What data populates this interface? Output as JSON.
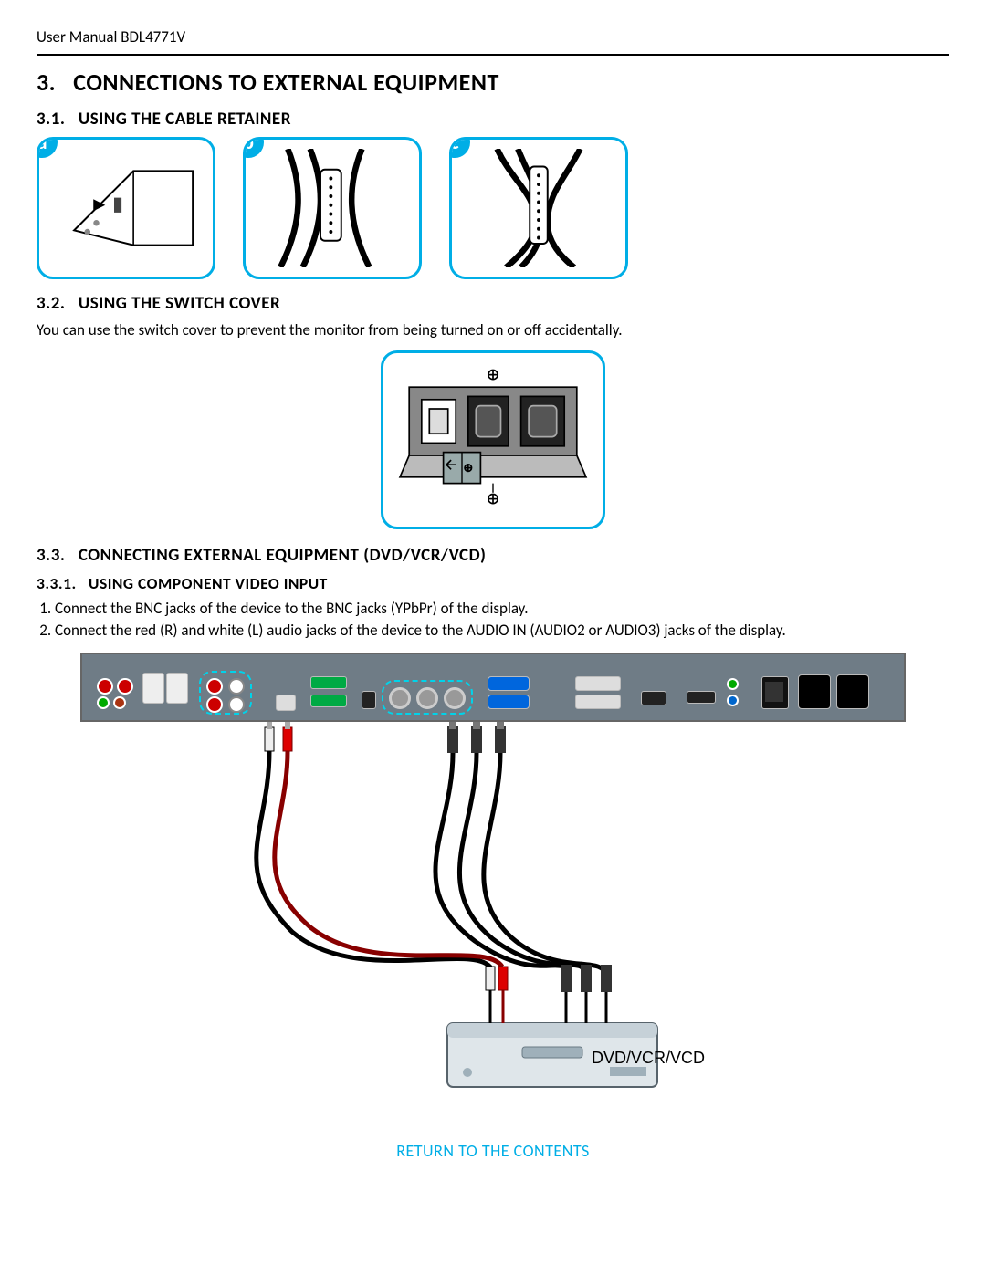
{
  "header": {
    "doc_title": "User Manual BDL4771V"
  },
  "section": {
    "num": "3.",
    "title": "CONNECTIONS TO EXTERNAL EQUIPMENT",
    "s31": {
      "num": "3.1.",
      "title": "USING THE CABLE RETAINER"
    },
    "s32": {
      "num": "3.2.",
      "title": "USING THE SWITCH COVER",
      "body": "You can use the switch cover to prevent the monitor from being turned on or off accidentally."
    },
    "s33": {
      "num": "3.3.",
      "title": "CONNECTING EXTERNAL EQUIPMENT (DVD/VCR/VCD)"
    },
    "s331": {
      "num": "3.3.1.",
      "title": "USING COMPONENT VIDEO INPUT",
      "steps": [
        "Connect the BNC jacks of the device to the BNC jacks (YPbPr) of the display.",
        "Connect the red (R) and white (L) audio jacks of the device to the AUDIO IN (AUDIO2 or AUDIO3) jacks of the display."
      ]
    }
  },
  "badges": {
    "a": "a",
    "b": "b",
    "c": "c"
  },
  "device_label": "DVD/VCR/VCD",
  "footer_link": "RETURN TO THE CONTENTS",
  "colors": {
    "accent": "#00aee6",
    "panel": "#6f7c86"
  }
}
